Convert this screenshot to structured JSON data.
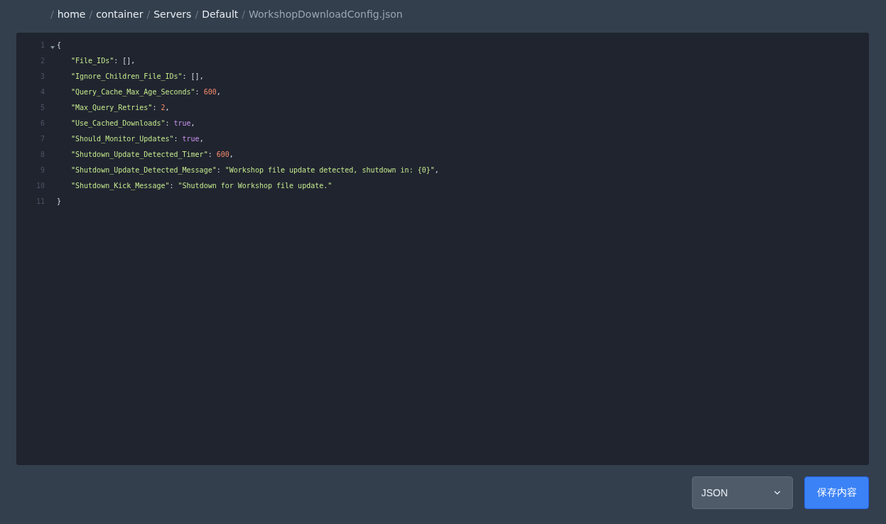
{
  "breadcrumb": {
    "separator": "/",
    "segments": [
      {
        "label": "home",
        "current": false
      },
      {
        "label": "container",
        "current": false
      },
      {
        "label": "Servers",
        "current": false
      },
      {
        "label": "Default",
        "current": false
      },
      {
        "label": "WorkshopDownloadConfig.json",
        "current": true
      }
    ]
  },
  "editor": {
    "lines": [
      {
        "number": "1",
        "kind": "brace",
        "expanded": true,
        "tokens": [
          {
            "kind": "punct",
            "text": "{"
          }
        ]
      },
      {
        "number": "2",
        "kind": "member",
        "tokens": [
          {
            "kind": "key",
            "text": "\"File_IDs\""
          },
          {
            "kind": "punct",
            "text": ": [],"
          }
        ]
      },
      {
        "number": "3",
        "kind": "member",
        "tokens": [
          {
            "kind": "key",
            "text": "\"Ignore_Children_File_IDs\""
          },
          {
            "kind": "punct",
            "text": ": [],"
          }
        ]
      },
      {
        "number": "4",
        "kind": "member",
        "tokens": [
          {
            "kind": "key",
            "text": "\"Query_Cache_Max_Age_Seconds\""
          },
          {
            "kind": "punct",
            "text": ": "
          },
          {
            "kind": "number",
            "text": "600"
          },
          {
            "kind": "punct",
            "text": ","
          }
        ]
      },
      {
        "number": "5",
        "kind": "member",
        "tokens": [
          {
            "kind": "key",
            "text": "\"Max_Query_Retries\""
          },
          {
            "kind": "punct",
            "text": ": "
          },
          {
            "kind": "number",
            "text": "2"
          },
          {
            "kind": "punct",
            "text": ","
          }
        ]
      },
      {
        "number": "6",
        "kind": "member",
        "tokens": [
          {
            "kind": "key",
            "text": "\"Use_Cached_Downloads\""
          },
          {
            "kind": "punct",
            "text": ": "
          },
          {
            "kind": "bool",
            "text": "true"
          },
          {
            "kind": "punct",
            "text": ","
          }
        ]
      },
      {
        "number": "7",
        "kind": "member",
        "tokens": [
          {
            "kind": "key",
            "text": "\"Should_Monitor_Updates\""
          },
          {
            "kind": "punct",
            "text": ": "
          },
          {
            "kind": "bool",
            "text": "true"
          },
          {
            "kind": "punct",
            "text": ","
          }
        ]
      },
      {
        "number": "8",
        "kind": "member",
        "tokens": [
          {
            "kind": "key",
            "text": "\"Shutdown_Update_Detected_Timer\""
          },
          {
            "kind": "punct",
            "text": ": "
          },
          {
            "kind": "number",
            "text": "600"
          },
          {
            "kind": "punct",
            "text": ","
          }
        ]
      },
      {
        "number": "9",
        "kind": "member",
        "tokens": [
          {
            "kind": "key",
            "text": "\"Shutdown_Update_Detected_Message\""
          },
          {
            "kind": "punct",
            "text": ": "
          },
          {
            "kind": "string",
            "text": "\"Workshop file update detected, shutdown in: {0}\""
          },
          {
            "kind": "punct",
            "text": ","
          }
        ]
      },
      {
        "number": "10",
        "kind": "member",
        "tokens": [
          {
            "kind": "key",
            "text": "\"Shutdown_Kick_Message\""
          },
          {
            "kind": "punct",
            "text": ": "
          },
          {
            "kind": "string",
            "text": "\"Shutdown for Workshop file update.\""
          }
        ]
      },
      {
        "number": "11",
        "kind": "brace",
        "tokens": [
          {
            "kind": "punct",
            "text": "}"
          }
        ]
      }
    ]
  },
  "footer": {
    "mode_select": {
      "value": "JSON"
    },
    "save_button": {
      "label": "保存内容"
    }
  }
}
